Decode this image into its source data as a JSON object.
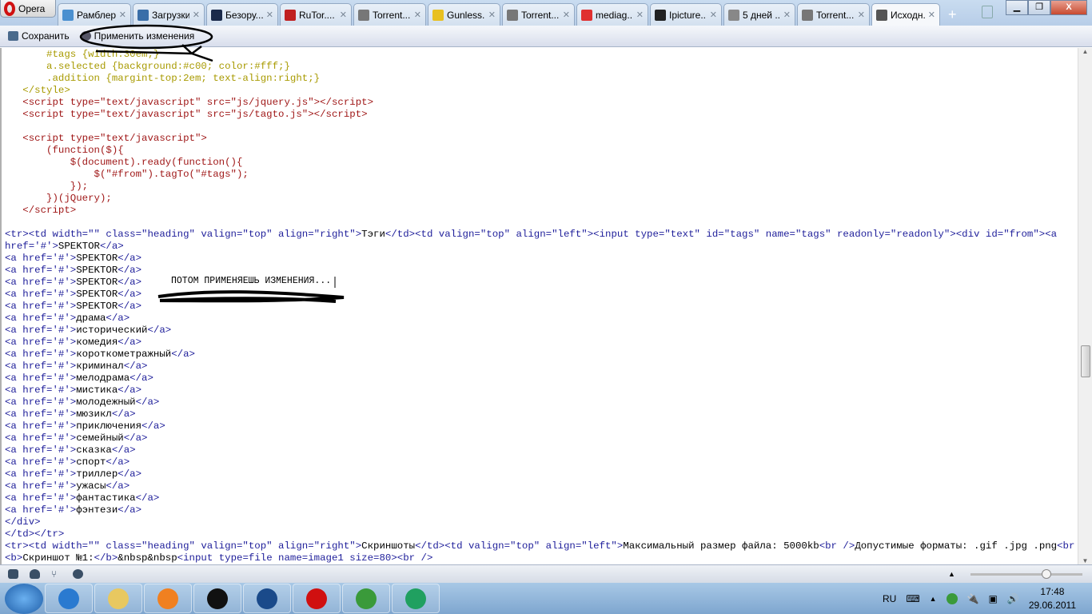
{
  "browser": {
    "menu_label": "Opera",
    "tabs": [
      {
        "label": "Рамблер",
        "icon": "rambler-icon",
        "color": "#4a90d0"
      },
      {
        "label": "Загрузки",
        "icon": "downloads-icon",
        "color": "#3a6ea8"
      },
      {
        "label": "Безору...",
        "icon": "k-icon",
        "color": "#1a2a4a"
      },
      {
        "label": "RuTor....",
        "icon": "rutor-icon",
        "color": "#c02020"
      },
      {
        "label": "Torrent...",
        "icon": "torrent-icon",
        "color": "#777777"
      },
      {
        "label": "Gunless...",
        "icon": "imdb-icon",
        "color": "#e8c020"
      },
      {
        "label": "Torrent...",
        "icon": "torrent-icon",
        "color": "#777777"
      },
      {
        "label": "mediag...",
        "icon": "yandex-icon",
        "color": "#e03030"
      },
      {
        "label": "Ipicture...",
        "icon": "ipicture-icon",
        "color": "#222222"
      },
      {
        "label": "5 дней ...",
        "icon": "film-icon",
        "color": "#888888"
      },
      {
        "label": "Torrent...",
        "icon": "torrent-icon",
        "color": "#777777"
      },
      {
        "label": "Исходн...",
        "icon": "document-icon",
        "color": "#555555",
        "active": true
      }
    ]
  },
  "toolbar": {
    "save_label": "Сохранить",
    "apply_label": "Применить изменения"
  },
  "annotation": {
    "text": "ПОТОМ ПРИМЕНЯЕШЬ ИЗМЕНЕНИЯ..."
  },
  "code_lines": [
    [
      [
        "css",
        "       #tags {width:30em;}"
      ]
    ],
    [
      [
        "css",
        "       a.selected {background:#c00; color:#fff;}"
      ]
    ],
    [
      [
        "css",
        "       .addition {margint-top:2em; text-align:right;}"
      ]
    ],
    [
      [
        "css",
        "   </style>"
      ]
    ],
    [
      [
        "js",
        "   <script type=\"text/javascript\" src=\"js/jquery.js\"></script>"
      ]
    ],
    [
      [
        "js",
        "   <script type=\"text/javascript\" src=\"js/tagto.js\"></script>"
      ]
    ],
    [],
    [
      [
        "js",
        "   <script type=\"text/javascript\">"
      ]
    ],
    [
      [
        "js",
        "       (function($){"
      ]
    ],
    [
      [
        "js",
        "           $(document).ready(function(){"
      ]
    ],
    [
      [
        "js",
        "               $(\"#from\").tagTo(\"#tags\");"
      ]
    ],
    [
      [
        "js",
        "           });"
      ]
    ],
    [
      [
        "js",
        "       })(jQuery);"
      ]
    ],
    [
      [
        "js",
        "   </script>"
      ]
    ],
    [],
    [
      [
        "tag",
        "<tr><td width=\"\" class=\"heading\" valign=\"top\" align=\"right\">"
      ],
      [
        "txt",
        "Тэги"
      ],
      [
        "tag",
        "</td><td valign=\"top\" align=\"left\"><input type=\"text\" id=\"tags\" name=\"tags\" readonly=\"readonly\"><div id=\"from\"><a"
      ]
    ],
    [
      [
        "tag",
        "href='#'>"
      ],
      [
        "txt",
        "SPEKTOR"
      ],
      [
        "tag",
        "</a>"
      ]
    ],
    [
      [
        "tag",
        "<a href='#'>"
      ],
      [
        "txt",
        "SPEKTOR"
      ],
      [
        "tag",
        "</a>"
      ]
    ],
    [
      [
        "tag",
        "<a href='#'>"
      ],
      [
        "txt",
        "SPEKTOR"
      ],
      [
        "tag",
        "</a>"
      ]
    ],
    [
      [
        "tag",
        "<a href='#'>"
      ],
      [
        "txt",
        "SPEKTOR"
      ],
      [
        "tag",
        "</a>"
      ]
    ],
    [
      [
        "tag",
        "<a href='#'>"
      ],
      [
        "txt",
        "SPEKTOR"
      ],
      [
        "tag",
        "</a>"
      ]
    ],
    [
      [
        "tag",
        "<a href='#'>"
      ],
      [
        "txt",
        "SPEKTOR"
      ],
      [
        "tag",
        "</a>"
      ]
    ],
    [
      [
        "tag",
        "<a href='#'>"
      ],
      [
        "txt",
        "драма"
      ],
      [
        "tag",
        "</a>"
      ]
    ],
    [
      [
        "tag",
        "<a href='#'>"
      ],
      [
        "txt",
        "исторический"
      ],
      [
        "tag",
        "</a>"
      ]
    ],
    [
      [
        "tag",
        "<a href='#'>"
      ],
      [
        "txt",
        "комедия"
      ],
      [
        "tag",
        "</a>"
      ]
    ],
    [
      [
        "tag",
        "<a href='#'>"
      ],
      [
        "txt",
        "короткометражный"
      ],
      [
        "tag",
        "</a>"
      ]
    ],
    [
      [
        "tag",
        "<a href='#'>"
      ],
      [
        "txt",
        "криминал"
      ],
      [
        "tag",
        "</a>"
      ]
    ],
    [
      [
        "tag",
        "<a href='#'>"
      ],
      [
        "txt",
        "мелодрама"
      ],
      [
        "tag",
        "</a>"
      ]
    ],
    [
      [
        "tag",
        "<a href='#'>"
      ],
      [
        "txt",
        "мистика"
      ],
      [
        "tag",
        "</a>"
      ]
    ],
    [
      [
        "tag",
        "<a href='#'>"
      ],
      [
        "txt",
        "молодежный"
      ],
      [
        "tag",
        "</a>"
      ]
    ],
    [
      [
        "tag",
        "<a href='#'>"
      ],
      [
        "txt",
        "мюзикл"
      ],
      [
        "tag",
        "</a>"
      ]
    ],
    [
      [
        "tag",
        "<a href='#'>"
      ],
      [
        "txt",
        "приключения"
      ],
      [
        "tag",
        "</a>"
      ]
    ],
    [
      [
        "tag",
        "<a href='#'>"
      ],
      [
        "txt",
        "семейный"
      ],
      [
        "tag",
        "</a>"
      ]
    ],
    [
      [
        "tag",
        "<a href='#'>"
      ],
      [
        "txt",
        "сказка"
      ],
      [
        "tag",
        "</a>"
      ]
    ],
    [
      [
        "tag",
        "<a href='#'>"
      ],
      [
        "txt",
        "спорт"
      ],
      [
        "tag",
        "</a>"
      ]
    ],
    [
      [
        "tag",
        "<a href='#'>"
      ],
      [
        "txt",
        "триллер"
      ],
      [
        "tag",
        "</a>"
      ]
    ],
    [
      [
        "tag",
        "<a href='#'>"
      ],
      [
        "txt",
        "ужасы"
      ],
      [
        "tag",
        "</a>"
      ]
    ],
    [
      [
        "tag",
        "<a href='#'>"
      ],
      [
        "txt",
        "фантастика"
      ],
      [
        "tag",
        "</a>"
      ]
    ],
    [
      [
        "tag",
        "<a href='#'>"
      ],
      [
        "txt",
        "фэнтези"
      ],
      [
        "tag",
        "</a>"
      ]
    ],
    [
      [
        "tag",
        "</div>"
      ]
    ],
    [
      [
        "tag",
        "</td></tr>"
      ]
    ],
    [
      [
        "tag",
        "<tr><td width=\"\" class=\"heading\" valign=\"top\" align=\"right\">"
      ],
      [
        "txt",
        "Скриншоты"
      ],
      [
        "tag",
        "</td><td valign=\"top\" align=\"left\">"
      ],
      [
        "txt",
        "Максимальный размер файла: 5000kb"
      ],
      [
        "tag",
        "<br />"
      ],
      [
        "txt",
        "Допустимые форматы: .gif .jpg .png"
      ],
      [
        "tag",
        "<br />"
      ]
    ],
    [
      [
        "tag",
        "<b>"
      ],
      [
        "txt",
        "Скриншот №1:"
      ],
      [
        "tag",
        "</b>"
      ],
      [
        "txt",
        "&nbsp&nbsp"
      ],
      [
        "tag",
        "<input type=file name=image1 size=80><br />"
      ]
    ]
  ],
  "scroll_position": 0.62,
  "zoom_level": 0.68,
  "tray": {
    "lang": "RU",
    "time": "17:48",
    "date": "29.06.2011"
  },
  "taskbar_apps": [
    {
      "name": "internet-explorer-icon",
      "color": "#2a7ad0"
    },
    {
      "name": "file-explorer-icon",
      "color": "#e8c860"
    },
    {
      "name": "media-player-icon",
      "color": "#f08020"
    },
    {
      "name": "hp-icon",
      "color": "#111111"
    },
    {
      "name": "app-check-icon",
      "color": "#1a4a8a"
    },
    {
      "name": "opera-icon",
      "color": "#d01010"
    },
    {
      "name": "utorrent-icon",
      "color": "#3a9a3a"
    },
    {
      "name": "green-app-icon",
      "color": "#20a060"
    }
  ]
}
